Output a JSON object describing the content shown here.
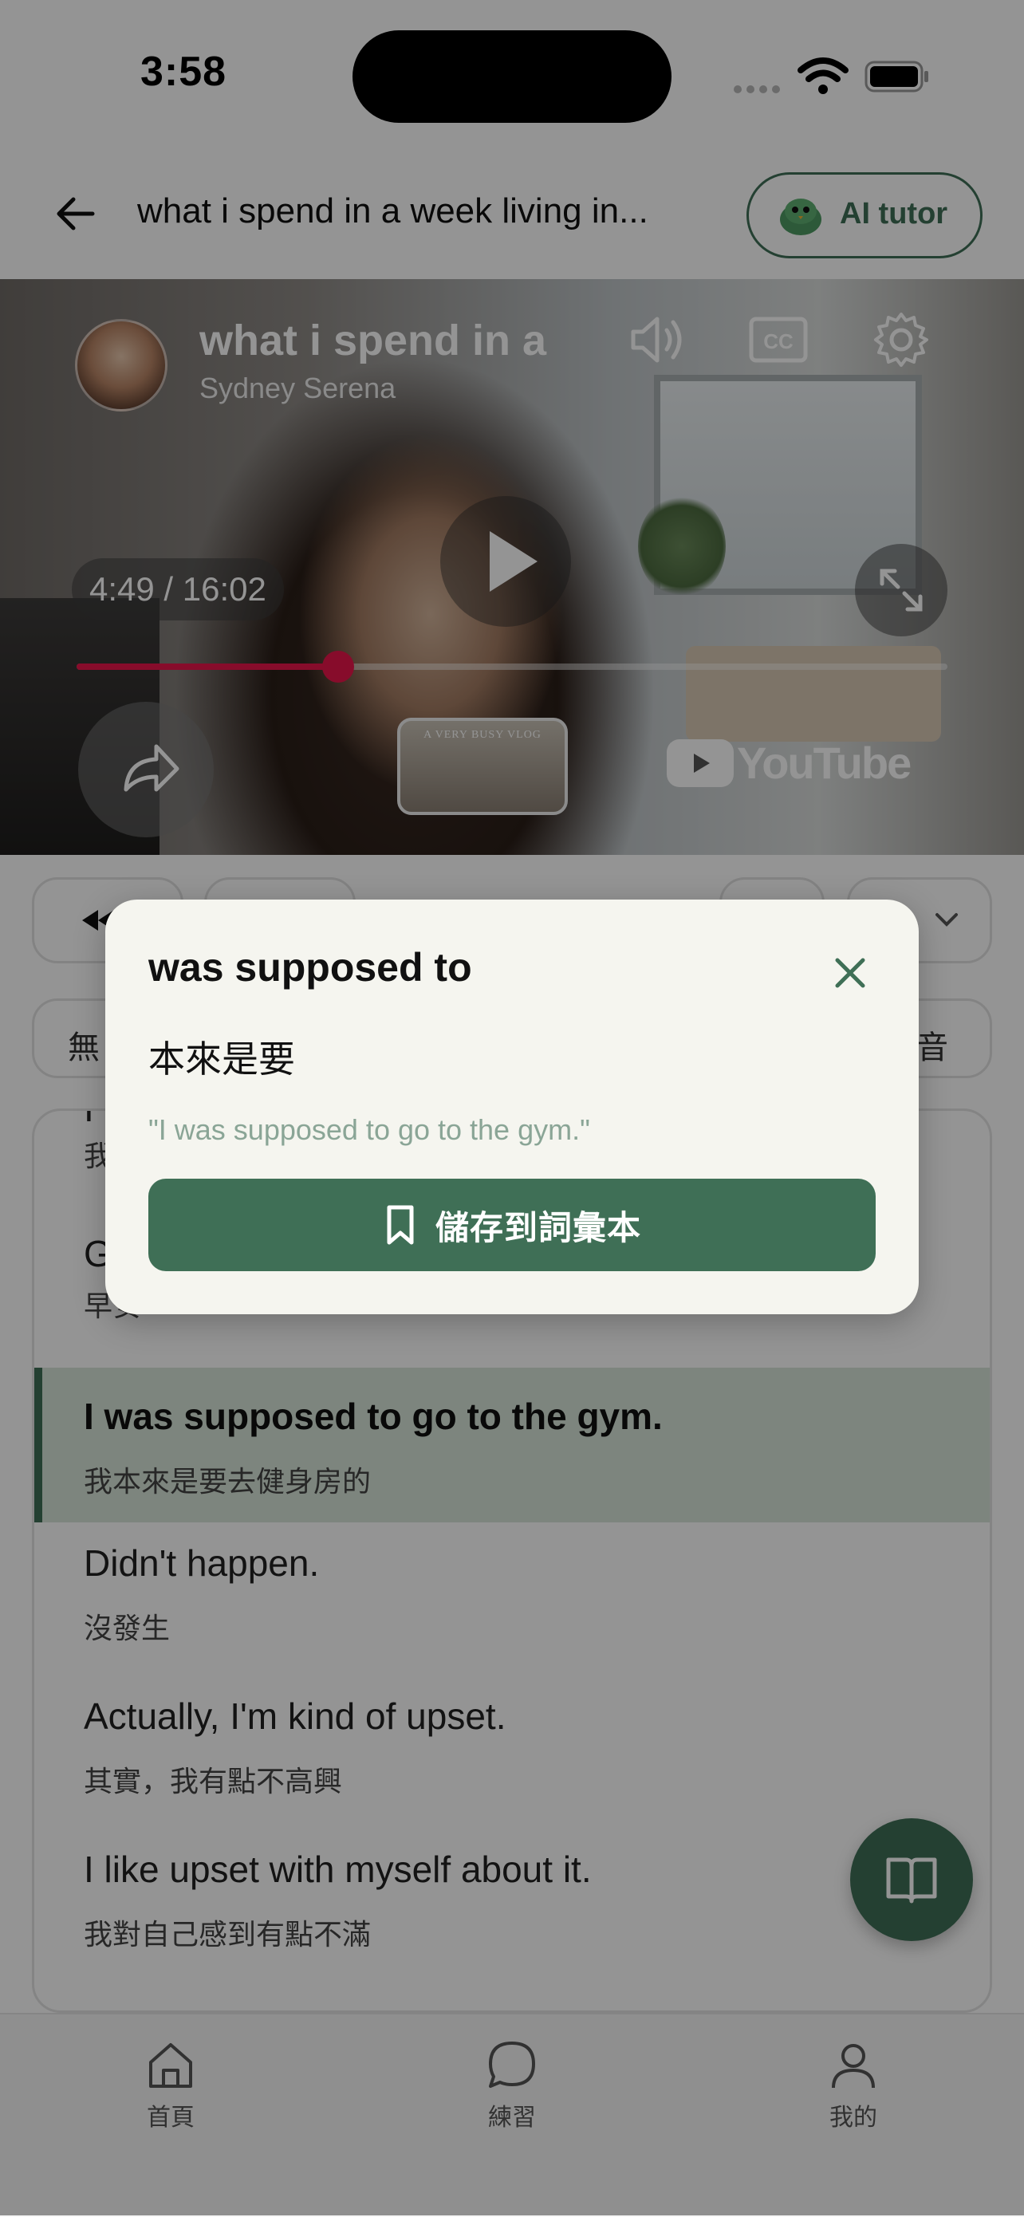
{
  "status_bar": {
    "time": "3:58"
  },
  "header": {
    "back_icon": "arrow-left-icon",
    "title": "what i spend in a week living in...",
    "tutor_label": "AI tutor"
  },
  "video": {
    "title": "what i spend in a",
    "channel": "Sydney Serena",
    "time_display": "4:49 / 16:02",
    "progress_fraction": 0.3,
    "thumbnail_text": "A VERY BUSY VLOG",
    "platform_label": "YouTube",
    "accent_color": "#e8164a"
  },
  "controls": {
    "row1_partial": [
      "",
      "",
      "",
      ""
    ],
    "filter_left": "無",
    "filter_right": "錄音"
  },
  "transcript": {
    "lines": [
      {
        "en": "I",
        "zh": "我"
      },
      {
        "en": "G",
        "zh": "早安"
      },
      {
        "en": "I was supposed to go to the gym.",
        "zh": "我本來是要去健身房的",
        "active": true
      },
      {
        "en": "Didn't happen.",
        "zh": "沒發生"
      },
      {
        "en": "Actually, I'm kind of upset.",
        "zh": "其實，我有點不高興"
      },
      {
        "en": "I like upset with myself about it.",
        "zh": "我對自己感到有點不滿"
      }
    ]
  },
  "tabbar": {
    "tabs": [
      {
        "label": "首頁",
        "icon": "home-icon"
      },
      {
        "label": "練習",
        "icon": "chat-bubble-icon"
      },
      {
        "label": "我的",
        "icon": "person-icon"
      }
    ]
  },
  "popup": {
    "phrase": "was supposed to",
    "translation": "本來是要",
    "example": "\"I was supposed to go to the gym.\"",
    "save_label": "儲存到詞彙本"
  },
  "colors": {
    "primary": "#3f6f56",
    "active_line_bg": "#d7e6d9",
    "popup_bg": "#f5f5ef"
  }
}
